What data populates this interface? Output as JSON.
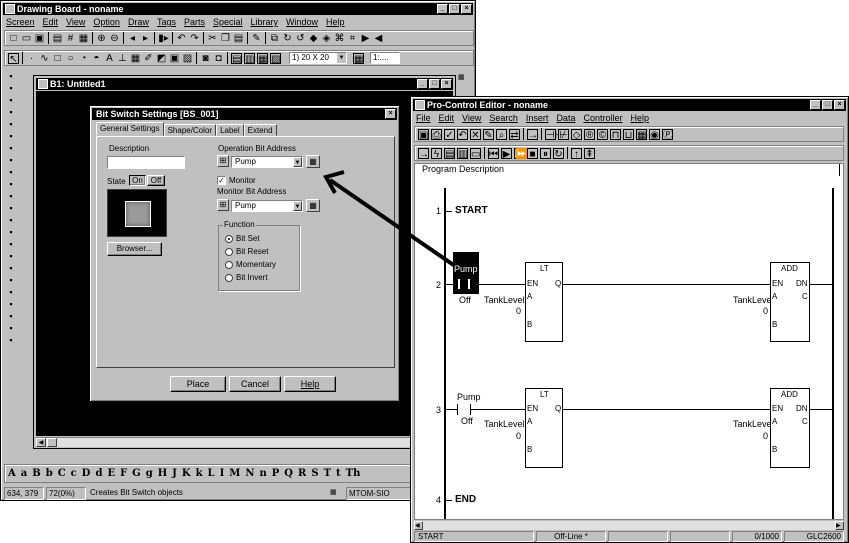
{
  "drawing_board": {
    "title": "Drawing Board - noname",
    "menu": [
      "Screen",
      "Edit",
      "View",
      "Option",
      "Draw",
      "Tags",
      "Parts",
      "Special",
      "Library",
      "Window",
      "Help"
    ],
    "zoom_select": "1) 20 X 20",
    "extra_select": "1:....",
    "font_letters": [
      "A",
      "a",
      "B",
      "b",
      "C",
      "c",
      "D",
      "d",
      "E",
      "F",
      "G",
      "g",
      "H",
      "J",
      "K",
      "k",
      "L",
      "I",
      "M",
      "N",
      "n",
      "P",
      "Q",
      "R",
      "S",
      "T",
      "t",
      "Th"
    ],
    "status": {
      "coords": "634, 379",
      "zoom": "72(0%)",
      "message": "Creates Bit Switch objects",
      "driver": "MTOM-SIO"
    }
  },
  "child_window": {
    "title": "B1: Untitled1"
  },
  "dialog": {
    "title": "Bit Switch Settings [BS_001]",
    "tabs": [
      "General Settings",
      "Shape/Color",
      "Label",
      "Extend"
    ],
    "description_label": "Description",
    "description_value": "",
    "state_label": "State",
    "state_on": "On",
    "state_off": "Off",
    "browse_button": "Browser...",
    "operation_label": "Operation Bit Address",
    "operation_value": "Pump",
    "monitor_checkbox": "Monitor",
    "monitor_label": "Monitor Bit Address",
    "monitor_value": "Pump",
    "function_label": "Function",
    "functions": [
      "Bit Set",
      "Bit Reset",
      "Momentary",
      "Bit Invert"
    ],
    "selected_function": "Bit Set",
    "place": "Place",
    "cancel": "Cancel",
    "help": "Help"
  },
  "editor": {
    "title": "Pro-Control Editor - noname",
    "menu": [
      "File",
      "Edit",
      "View",
      "Search",
      "Insert",
      "Data",
      "Controller",
      "Help"
    ],
    "program_description": "Program Description",
    "rungs": [
      {
        "num": "1",
        "label": "START"
      },
      {
        "num": "2"
      },
      {
        "num": "3"
      },
      {
        "num": "4",
        "label": "END"
      }
    ],
    "rung2": {
      "contact": "Pump",
      "contact_state": "Off",
      "lt_title": "LT",
      "add_title": "ADD",
      "en": "EN",
      "q": "Q",
      "dn": "DN",
      "a": "A",
      "b": "B",
      "c": "C",
      "var": "TankLevel",
      "zero": "0"
    },
    "rung3": {
      "contact": "Pump",
      "contact_state": "Off",
      "lt_title": "LT",
      "add_title": "ADD",
      "en": "EN",
      "q": "Q",
      "dn": "DN",
      "a": "A",
      "b": "B",
      "c": "C",
      "var": "TankLevel",
      "zero": "0"
    },
    "status": {
      "rung": "START",
      "mode": "Off-Line *",
      "count": "0/1000",
      "plc": "GLC2600"
    }
  }
}
